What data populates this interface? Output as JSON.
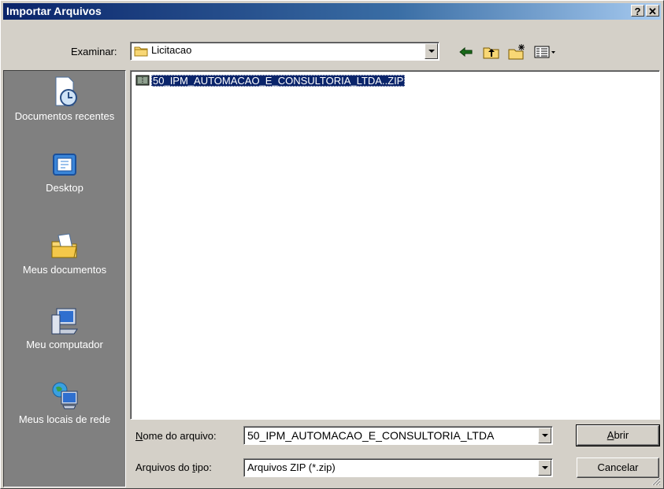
{
  "window": {
    "title": "Importar Arquivos",
    "help_label": "?",
    "close_label": "✕"
  },
  "lookin": {
    "label": "Examinar:",
    "value": "Licitacao"
  },
  "toolbar": {
    "back_icon": "back-arrow-icon",
    "up_icon": "up-folder-icon",
    "new_folder_icon": "new-folder-icon",
    "view_menu_icon": "view-menu-icon"
  },
  "places": [
    {
      "label": "Documentos recentes",
      "icon": "recent-documents-icon"
    },
    {
      "label": "Desktop",
      "icon": "desktop-icon"
    },
    {
      "label": "Meus documentos",
      "icon": "my-documents-icon"
    },
    {
      "label": "Meu computador",
      "icon": "my-computer-icon"
    },
    {
      "label": "Meus locais de rede",
      "icon": "network-places-icon"
    }
  ],
  "files": [
    {
      "name": "50_IPM_AUTOMACAO_E_CONSULTORIA_LTDA..ZIP",
      "selected": true,
      "icon": "zip-file-icon"
    }
  ],
  "filename": {
    "label": "Nome do arquivo:",
    "value": "50_IPM_AUTOMACAO_E_CONSULTORIA_LTDA"
  },
  "filetype": {
    "label": "Arquivos do tipo:",
    "value": "Arquivos ZIP (*.zip)"
  },
  "buttons": {
    "open": "Abrir",
    "cancel": "Cancelar"
  }
}
